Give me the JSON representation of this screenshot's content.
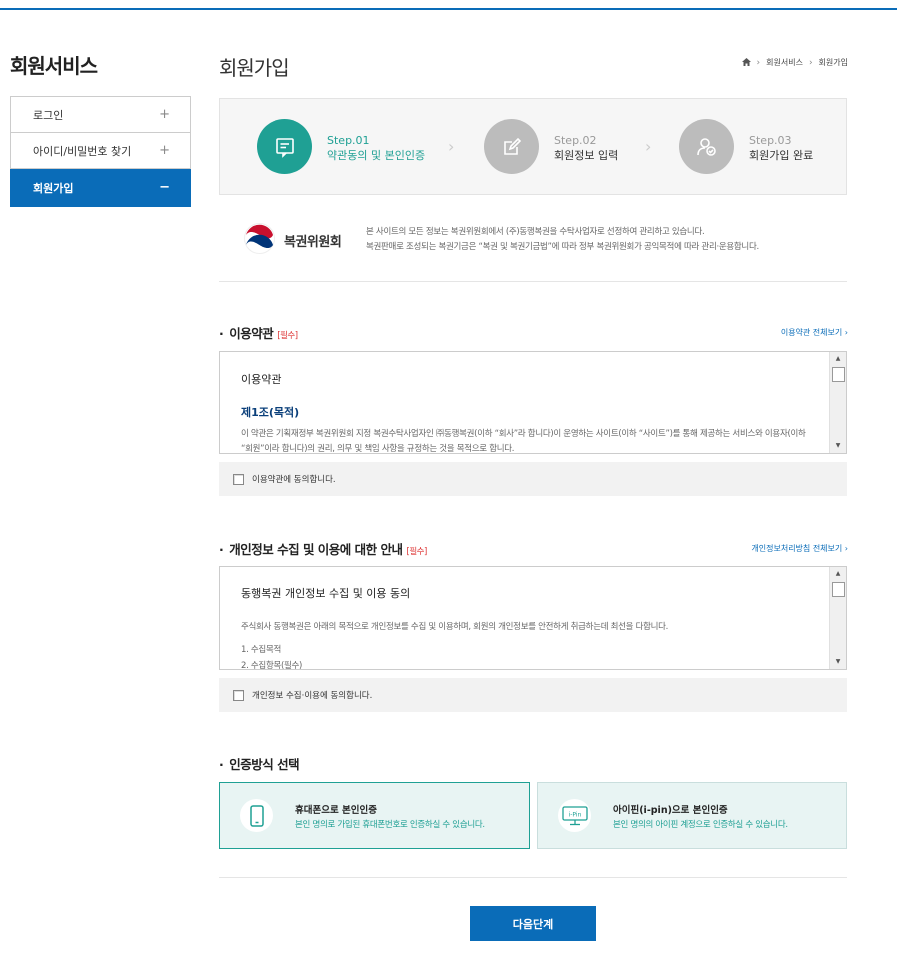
{
  "sidebar": {
    "title": "회원서비스",
    "items": [
      {
        "label": "로그인",
        "toggle": "+"
      },
      {
        "label": "아이디/비밀번호 찾기",
        "toggle": "+"
      },
      {
        "label": "회원가입",
        "toggle": "−"
      }
    ]
  },
  "header": {
    "title": "회원가입",
    "breadcrumb": [
      "회원서비스",
      "회원가입"
    ]
  },
  "steps": [
    {
      "no": "Step.01",
      "label": "약관동의 및 본인인증",
      "icon": "document-pen-icon",
      "active": true
    },
    {
      "no": "Step.02",
      "label": "회원정보 입력",
      "icon": "edit-icon",
      "active": false
    },
    {
      "no": "Step.03",
      "label": "회원가입 완료",
      "icon": "user-check-icon",
      "active": false
    }
  ],
  "agency": {
    "name": "복권위원회",
    "desc_line1": "본 사이트의 모든 정보는 복권위원회에서 (주)동행복권을 수탁사업자로 선정하여 관리하고 있습니다.",
    "desc_line2": "복권판매로 조성되는 복권기금은 “복권 및 복권기금법”에 따라 정부 복권위원회가 공익목적에 따라 관리·운용합니다."
  },
  "terms": {
    "title": "이용약관",
    "required": "[필수]",
    "link": "이용약관 전체보기 ›",
    "box_heading": "이용약관",
    "box_sub": "제1조(목적)",
    "box_body": "이 약관은 기획재정부 복권위원회 지정 복권수탁사업자인 ㈜동행복권(이하 “회사”라 합니다)이 운영하는 사이트(이하 “사이트”)를 통해 제공하는 서비스와 이용자(이하 “회원”이라 합니다)의 권리, 의무 및 책임 사항을 규정하는 것을 목적으로 합니다.",
    "agree_label": "이용약관에 동의합니다."
  },
  "privacy": {
    "title": "개인정보 수집 및 이용에 대한 안내",
    "required": "[필수]",
    "link": "개인정보처리방침 전체보기 ›",
    "box_heading": "동행복권 개인정보 수집 및 이용 동의",
    "box_body": "주식회사 동행복권은 아래의 목적으로 개인정보를 수집 및 이용하며, 회원의 개인정보를 안전하게 취급하는데 최선을 다합니다.",
    "item1": "1. 수집목적",
    "item2": "2. 수집항목(필수)",
    "agree_label": "개인정보 수집·이용에 동의합니다."
  },
  "auth": {
    "title": "인증방식 선택",
    "phone": {
      "title": "휴대폰으로 본인인증",
      "desc": "본인 명의로 가입된 휴대폰번호로 인증하실 수 있습니다.",
      "icon": "phone-icon"
    },
    "ipin": {
      "title": "아이핀(i-pin)으로 본인인증",
      "desc": "본인 명의의 아이핀 계정으로 인증하실 수 있습니다.",
      "icon": "ipin-icon",
      "icon_text": "i-Pin"
    }
  },
  "next_button": "다음단계"
}
